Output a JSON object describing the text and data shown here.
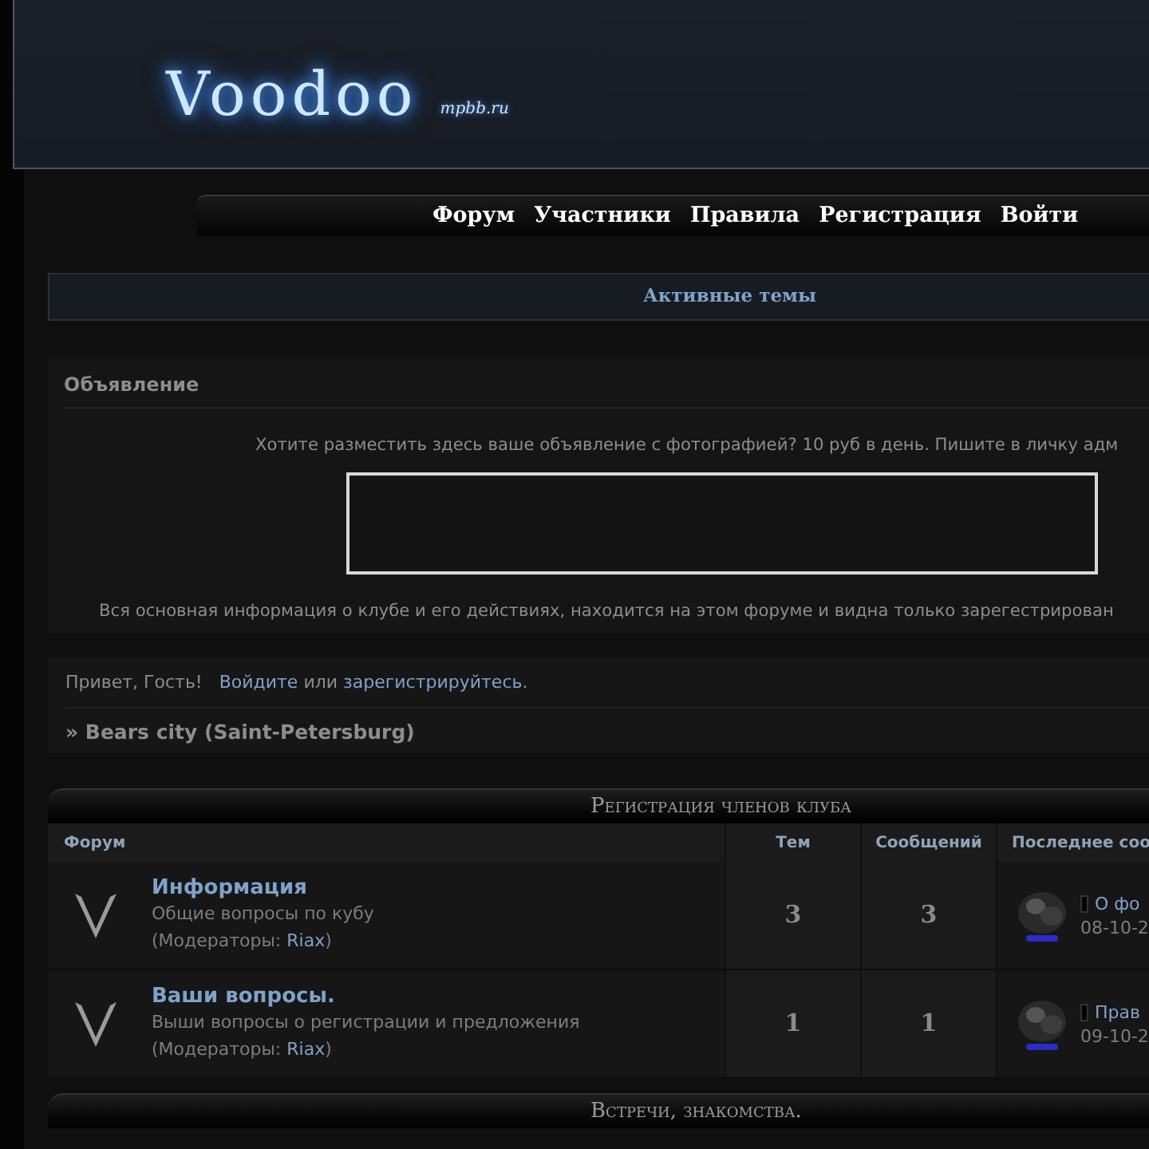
{
  "logo": {
    "text": "Voodoo",
    "domain": "mpbb.ru"
  },
  "nav": [
    "Форум",
    "Участники",
    "Правила",
    "Регистрация",
    "Войти"
  ],
  "active_topics": "Активные темы",
  "announcement": {
    "title": "Объявление",
    "text": "Хотите разместить здесь ваше объявление с фотографией? 10 руб в день. Пишите в личку адм",
    "note": "Вся основная информация о клубе и его действиях, находится на этом форуме и видна только зарегестрирован"
  },
  "greeting": {
    "hello": "Привет, Гость!",
    "login": "Войдите",
    "or": "или",
    "register": "зарегистрируйтесь",
    "end": "."
  },
  "breadcrumb": "» Bears city (Saint-Petersburg)",
  "categories": [
    {
      "title": "Регистрация членов клуба",
      "columns": [
        "Форум",
        "Тем",
        "Сообщений",
        "Последнее соо"
      ],
      "forums": [
        {
          "name": "Информация",
          "description": "Общие вопросы по кубу",
          "moderators_label": "(Модераторы:",
          "moderator": "Riax",
          "moderators_end": ")",
          "topics": "3",
          "posts": "3",
          "last_post": "О фо",
          "last_date": "08-10-2"
        },
        {
          "name": "Ваши вопросы.",
          "description": "Выши вопросы о регистрации и предложения",
          "moderators_label": "(Модераторы:",
          "moderator": "Riax",
          "moderators_end": ")",
          "topics": "1",
          "posts": "1",
          "last_post": "Прав",
          "last_date": "09-10-2"
        }
      ]
    },
    {
      "title": "Встречи, знакомства."
    }
  ]
}
